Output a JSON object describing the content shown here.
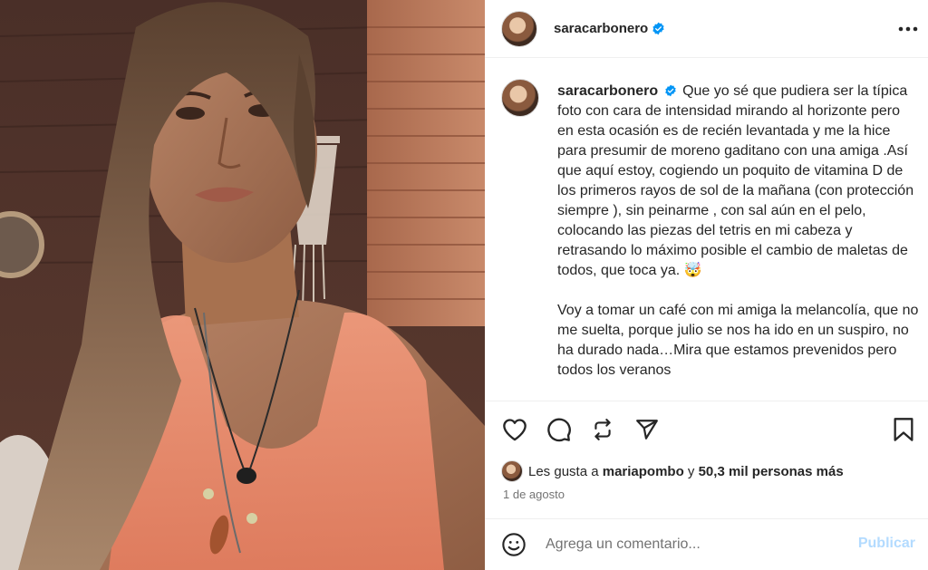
{
  "post": {
    "username": "saracarbonero",
    "more_options_icon": "ellipsis-horizontal-icon",
    "verified_icon": "verified-badge-icon"
  },
  "caption": {
    "username": "saracarbonero",
    "paragraph1": "Que yo sé que pudiera ser la típica foto con cara de intensidad mirando al horizonte pero en esta ocasión es de recién levantada y me la hice para presumir de moreno gaditano con una amiga .Así que aquí estoy, cogiendo un poquito de vitamina D de los primeros rayos de sol de la mañana (con protección siempre ), sin peinarme , con sal aún en el pelo, colocando las piezas del tetris en mi cabeza y retrasando lo máximo posible el cambio de maletas de todos, que toca ya. 🤯",
    "paragraph2": "Voy a tomar un café con mi amiga la melancolía, que no me suelta, porque julio se nos ha ido en un suspiro, no ha durado nada…Mira que estamos prevenidos pero todos los veranos"
  },
  "actions": {
    "like_icon": "heart-icon",
    "comment_icon": "comment-bubble-icon",
    "repost_icon": "repost-icon",
    "share_icon": "send-paper-plane-icon",
    "save_icon": "bookmark-icon"
  },
  "likes": {
    "prefix": "Les gusta a",
    "user": "mariapombo",
    "connector": "y",
    "others": "50,3 mil personas más"
  },
  "date": "1 de agosto",
  "comment": {
    "placeholder": "Agrega un comentario...",
    "publish_label": "Publicar",
    "emoji_icon": "smiley-face-icon"
  },
  "colors": {
    "verified_blue": "#0095f6",
    "publish_disabled": "#b3dbff",
    "text": "#262626",
    "muted": "#737373"
  }
}
